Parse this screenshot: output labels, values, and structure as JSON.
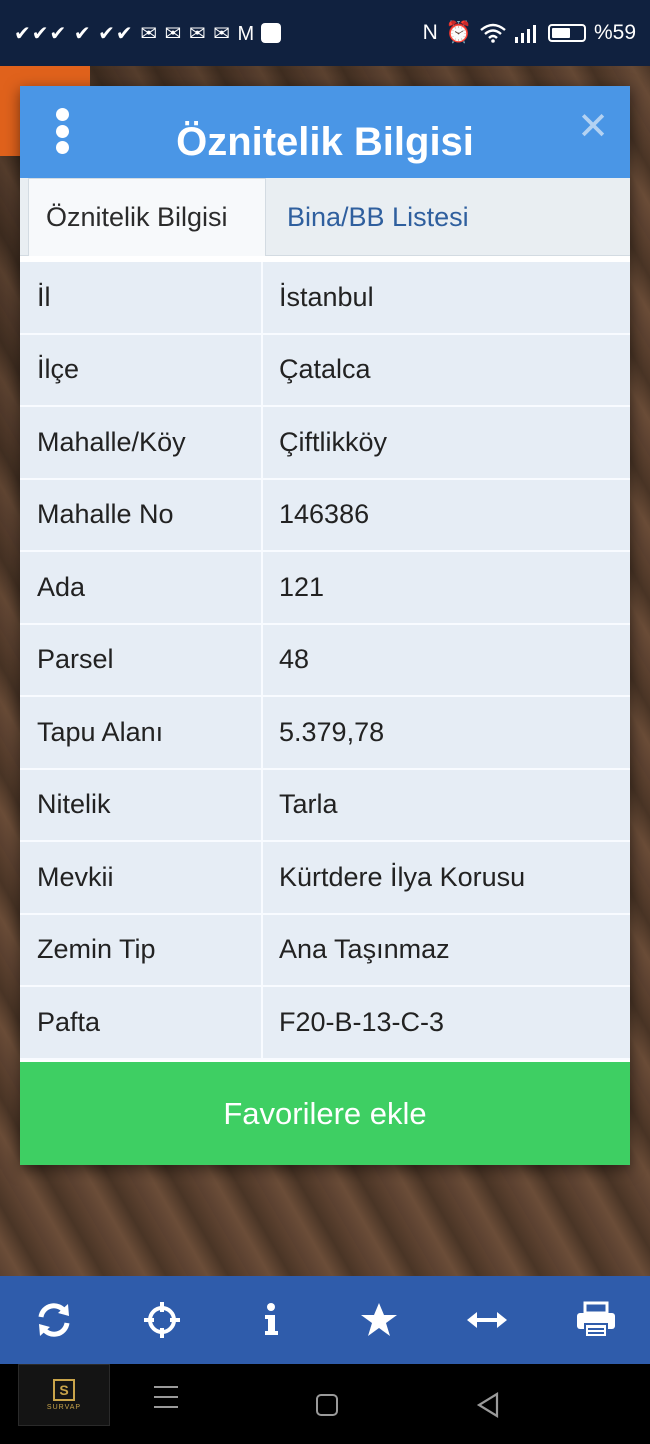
{
  "status_bar": {
    "notifications": "✔✔✔ ✔ ✔✔ ✉ ✉ ✉ ✉ M",
    "battery_level": "%59",
    "battery_fraction": 0.59
  },
  "dialog": {
    "title": "Öznitelik Bilgisi",
    "tabs": [
      {
        "label": "Öznitelik Bilgisi",
        "active": true
      },
      {
        "label": "Bina/BB Listesi",
        "active": false
      }
    ],
    "rows": [
      {
        "key": "İl",
        "value": "İstanbul"
      },
      {
        "key": "İlçe",
        "value": "Çatalca"
      },
      {
        "key": "Mahalle/Köy",
        "value": "Çiftlikköy"
      },
      {
        "key": "Mahalle No",
        "value": "146386"
      },
      {
        "key": "Ada",
        "value": "121"
      },
      {
        "key": "Parsel",
        "value": "48"
      },
      {
        "key": "Tapu Alanı",
        "value": "5.379,78"
      },
      {
        "key": "Nitelik",
        "value": "Tarla"
      },
      {
        "key": "Mevkii",
        "value": "Kürtdere İlya Korusu"
      },
      {
        "key": "Zemin Tip",
        "value": "Ana Taşınmaz"
      },
      {
        "key": "Pafta",
        "value": "F20-B-13-C-3"
      }
    ],
    "favorite_button": "Favorilere ekle"
  },
  "toolbar": {
    "icons": [
      "refresh-icon",
      "crosshair-icon",
      "info-icon",
      "star-icon",
      "resize-horizontal-icon",
      "print-icon"
    ]
  },
  "nav_logo_text": "SURVAP",
  "colors": {
    "header_blue": "#4a96e6",
    "favorite_green": "#3ecf63",
    "toolbar_blue": "#2f5cab"
  }
}
